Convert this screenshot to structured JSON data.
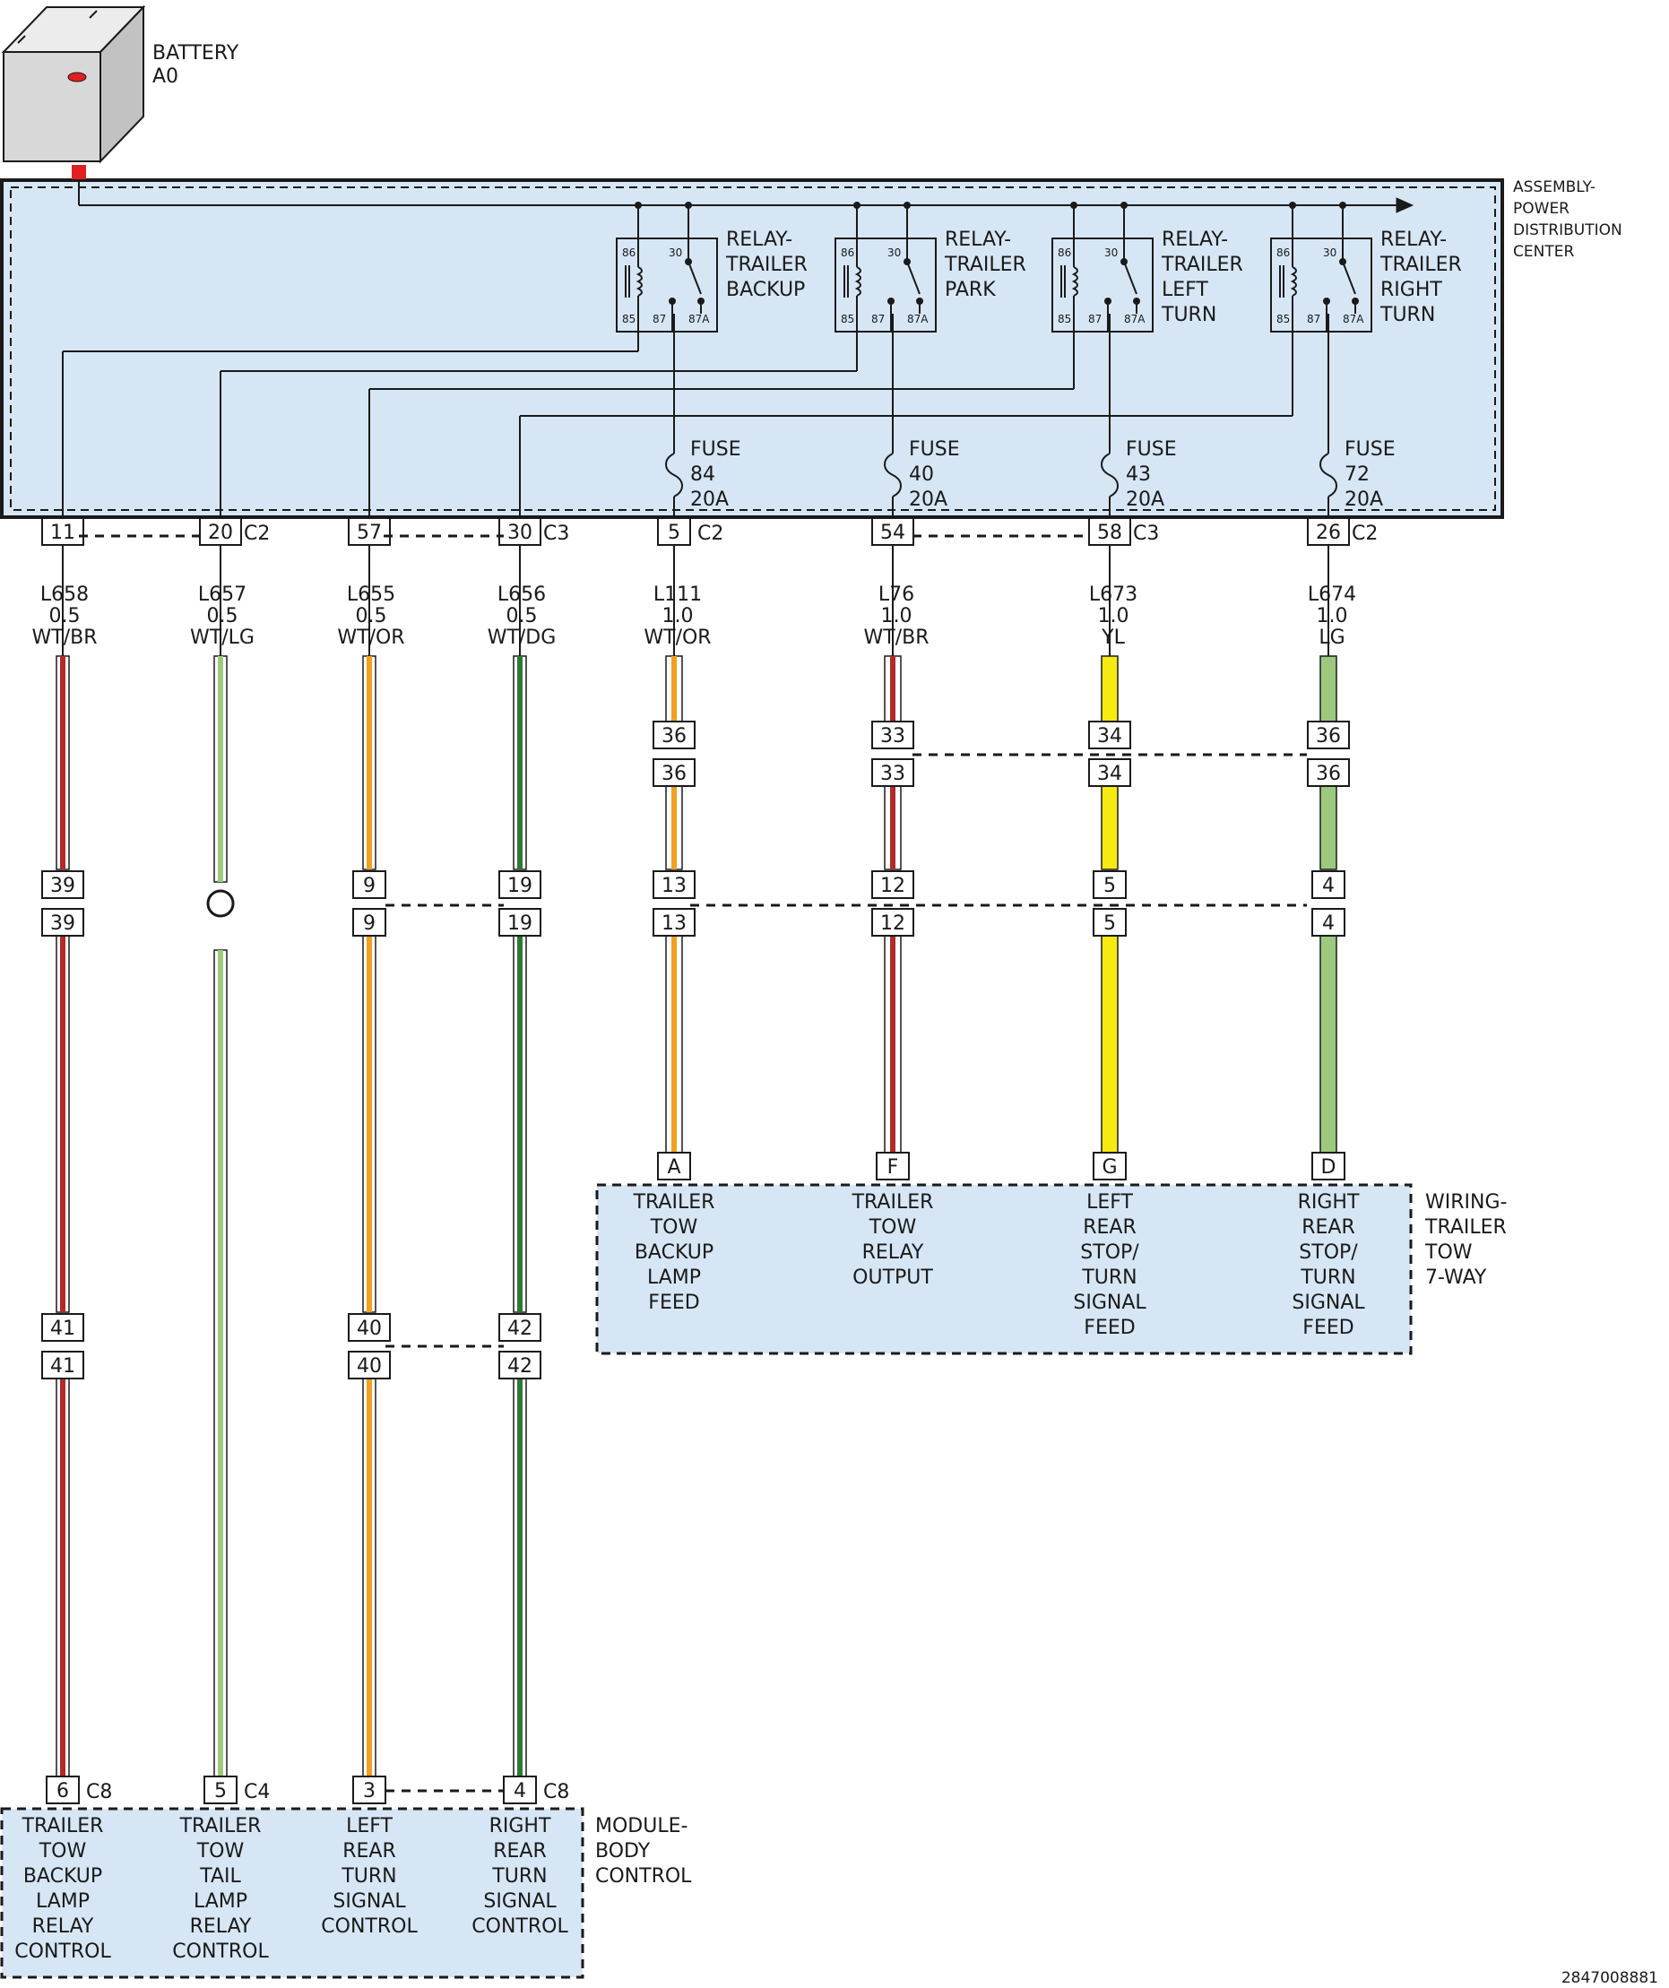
{
  "battery": {
    "line1": "BATTERY",
    "line2": "A0"
  },
  "pdc": {
    "name": [
      "ASSEMBLY-",
      "POWER",
      "DISTRIBUTION",
      "CENTER"
    ]
  },
  "relays": [
    {
      "lines": [
        "RELAY-",
        "TRAILER",
        "BACKUP"
      ],
      "terms": [
        "86",
        "30",
        "85",
        "87",
        "87A"
      ]
    },
    {
      "lines": [
        "RELAY-",
        "TRAILER",
        "PARK"
      ],
      "terms": [
        "86",
        "30",
        "85",
        "87",
        "87A"
      ]
    },
    {
      "lines": [
        "RELAY-",
        "TRAILER",
        "LEFT",
        "TURN"
      ],
      "terms": [
        "86",
        "30",
        "85",
        "87",
        "87A"
      ]
    },
    {
      "lines": [
        "RELAY-",
        "TRAILER",
        "RIGHT",
        "TURN"
      ],
      "terms": [
        "86",
        "30",
        "85",
        "87",
        "87A"
      ]
    }
  ],
  "fuses": [
    {
      "lines": [
        "FUSE",
        "84",
        "20A"
      ]
    },
    {
      "lines": [
        "FUSE",
        "40",
        "20A"
      ]
    },
    {
      "lines": [
        "FUSE",
        "43",
        "20A"
      ]
    },
    {
      "lines": [
        "FUSE",
        "72",
        "20A"
      ]
    }
  ],
  "wires": [
    {
      "top_pin": "11",
      "connector": "",
      "circuit": "L658",
      "gauge": "0.5",
      "color_code": "WT/BR",
      "base_color": "#ffffff",
      "stripe_color": "#b22a2a",
      "inline_1": [
        "",
        ""
      ],
      "inline_2": [
        "39",
        "39"
      ],
      "inline_3": [
        "41",
        "41"
      ],
      "end_pin": "6",
      "end_connector": "C8"
    },
    {
      "top_pin": "20",
      "connector": "C2",
      "circuit": "L657",
      "gauge": "0.5",
      "color_code": "WT/LG",
      "base_color": "#ffffff",
      "stripe_color": "#9cc97e",
      "inline_1": [
        "",
        ""
      ],
      "inline_2": [
        "",
        ""
      ],
      "inline_3": [
        "",
        ""
      ],
      "end_pin": "5",
      "end_connector": "C4"
    },
    {
      "top_pin": "57",
      "connector": "",
      "circuit": "L655",
      "gauge": "0.5",
      "color_code": "WT/OR",
      "base_color": "#ffffff",
      "stripe_color": "#f2a020",
      "inline_1": [
        "",
        ""
      ],
      "inline_2": [
        "9",
        "9"
      ],
      "inline_3": [
        "40",
        "40"
      ],
      "end_pin": "3",
      "end_connector": ""
    },
    {
      "top_pin": "30",
      "connector": "C3",
      "circuit": "L656",
      "gauge": "0.5",
      "color_code": "WT/DG",
      "base_color": "#ffffff",
      "stripe_color": "#2b7a34",
      "inline_1": [
        "",
        ""
      ],
      "inline_2": [
        "19",
        "19"
      ],
      "inline_3": [
        "42",
        "42"
      ],
      "end_pin": "4",
      "end_connector": "C8"
    },
    {
      "top_pin": "5",
      "connector": "C2",
      "circuit": "L111",
      "gauge": "1.0",
      "color_code": "WT/OR",
      "base_color": "#ffffff",
      "stripe_color": "#f2a020",
      "inline_1": [
        "36",
        "36"
      ],
      "inline_2": [
        "13",
        "13"
      ],
      "inline_3": [
        "",
        ""
      ],
      "end_pin": "A",
      "end_connector": ""
    },
    {
      "top_pin": "54",
      "connector": "",
      "circuit": "L76",
      "gauge": "1.0",
      "color_code": "WT/BR",
      "base_color": "#ffffff",
      "stripe_color": "#b22a2a",
      "inline_1": [
        "33",
        "33"
      ],
      "inline_2": [
        "12",
        "12"
      ],
      "inline_3": [
        "",
        ""
      ],
      "end_pin": "F",
      "end_connector": ""
    },
    {
      "top_pin": "58",
      "connector": "C3",
      "circuit": "L673",
      "gauge": "1.0",
      "color_code": "YL",
      "base_color": "#f6ea10",
      "stripe_color": "",
      "inline_1": [
        "34",
        "34"
      ],
      "inline_2": [
        "5",
        "5"
      ],
      "inline_3": [
        "",
        ""
      ],
      "end_pin": "G",
      "end_connector": ""
    },
    {
      "top_pin": "26",
      "connector": "C2",
      "circuit": "L674",
      "gauge": "1.0",
      "color_code": "LG",
      "base_color": "#9cc97e",
      "stripe_color": "",
      "inline_1": [
        "36",
        "36"
      ],
      "inline_2": [
        "4",
        "4"
      ],
      "inline_3": [
        "",
        ""
      ],
      "end_pin": "D",
      "end_connector": ""
    }
  ],
  "trailer_connector": {
    "name": [
      "WIRING-",
      "TRAILER",
      "TOW",
      "7-WAY"
    ],
    "functions": [
      [
        "TRAILER",
        "TOW",
        "BACKUP",
        "LAMP",
        "FEED"
      ],
      [
        "TRAILER",
        "TOW",
        "RELAY",
        "OUTPUT"
      ],
      [
        "LEFT",
        "REAR",
        "STOP/",
        "TURN",
        "SIGNAL",
        "FEED"
      ],
      [
        "RIGHT",
        "REAR",
        "STOP/",
        "TURN",
        "SIGNAL",
        "FEED"
      ]
    ]
  },
  "bcm": {
    "name": [
      "MODULE-",
      "BODY",
      "CONTROL"
    ],
    "functions": [
      [
        "TRAILER",
        "TOW",
        "BACKUP",
        "LAMP",
        "RELAY",
        "CONTROL"
      ],
      [
        "TRAILER",
        "TOW",
        "TAIL",
        "LAMP",
        "RELAY",
        "CONTROL"
      ],
      [
        "LEFT",
        "REAR",
        "TURN",
        "SIGNAL",
        "CONTROL"
      ],
      [
        "RIGHT",
        "REAR",
        "TURN",
        "SIGNAL",
        "CONTROL"
      ]
    ]
  },
  "figure_id": "2847008881",
  "colors": {
    "panel_fill": "#d6e6f5",
    "stroke": "#1a1a1a",
    "terminal_red": "#e02020"
  }
}
